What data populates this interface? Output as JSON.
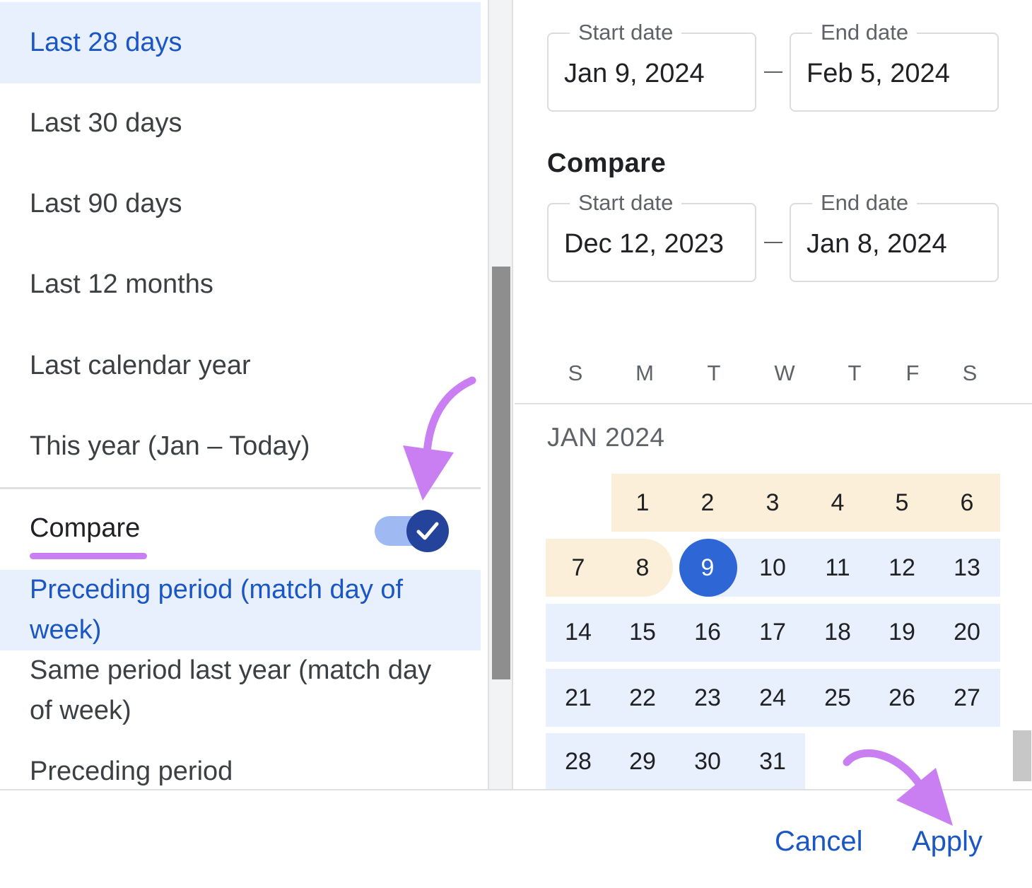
{
  "presets": {
    "items": [
      {
        "label": "Last 28 days",
        "selected": true
      },
      {
        "label": "Last 30 days",
        "selected": false
      },
      {
        "label": "Last 90 days",
        "selected": false
      },
      {
        "label": "Last 12 months",
        "selected": false
      },
      {
        "label": "Last calendar year",
        "selected": false
      },
      {
        "label": "This year (Jan – Today)",
        "selected": false
      }
    ]
  },
  "compare": {
    "label": "Compare",
    "toggle_on": true,
    "options": [
      {
        "label": "Preceding period (match day of week)",
        "selected": true
      },
      {
        "label": "Same period last year (match day of week)",
        "selected": false
      },
      {
        "label": "Preceding period",
        "selected": false
      }
    ]
  },
  "range": {
    "start_label": "Start date",
    "start_value": "Jan 9, 2024",
    "end_label": "End date",
    "end_value": "Feb 5, 2024"
  },
  "compare_range": {
    "title": "Compare",
    "start_label": "Start date",
    "start_value": "Dec 12, 2023",
    "end_label": "End date",
    "end_value": "Jan 8, 2024"
  },
  "calendar": {
    "weekdays": [
      "S",
      "M",
      "T",
      "W",
      "T",
      "F",
      "S"
    ],
    "month_label": "JAN 2024",
    "days": [
      "1",
      "2",
      "3",
      "4",
      "5",
      "6",
      "7",
      "8",
      "9",
      "10",
      "11",
      "12",
      "13",
      "14",
      "15",
      "16",
      "17",
      "18",
      "19",
      "20",
      "21",
      "22",
      "23",
      "24",
      "25",
      "26",
      "27",
      "28",
      "29",
      "30",
      "31"
    ],
    "selected_day": "9"
  },
  "actions": {
    "cancel": "Cancel",
    "apply": "Apply"
  },
  "colors": {
    "accent": "#1a56c4",
    "selected_bg": "#e8f0fe",
    "compare_range_bg": "#fcefd9",
    "selected_day": "#2f66d6",
    "annotation": "#c97ff2"
  }
}
